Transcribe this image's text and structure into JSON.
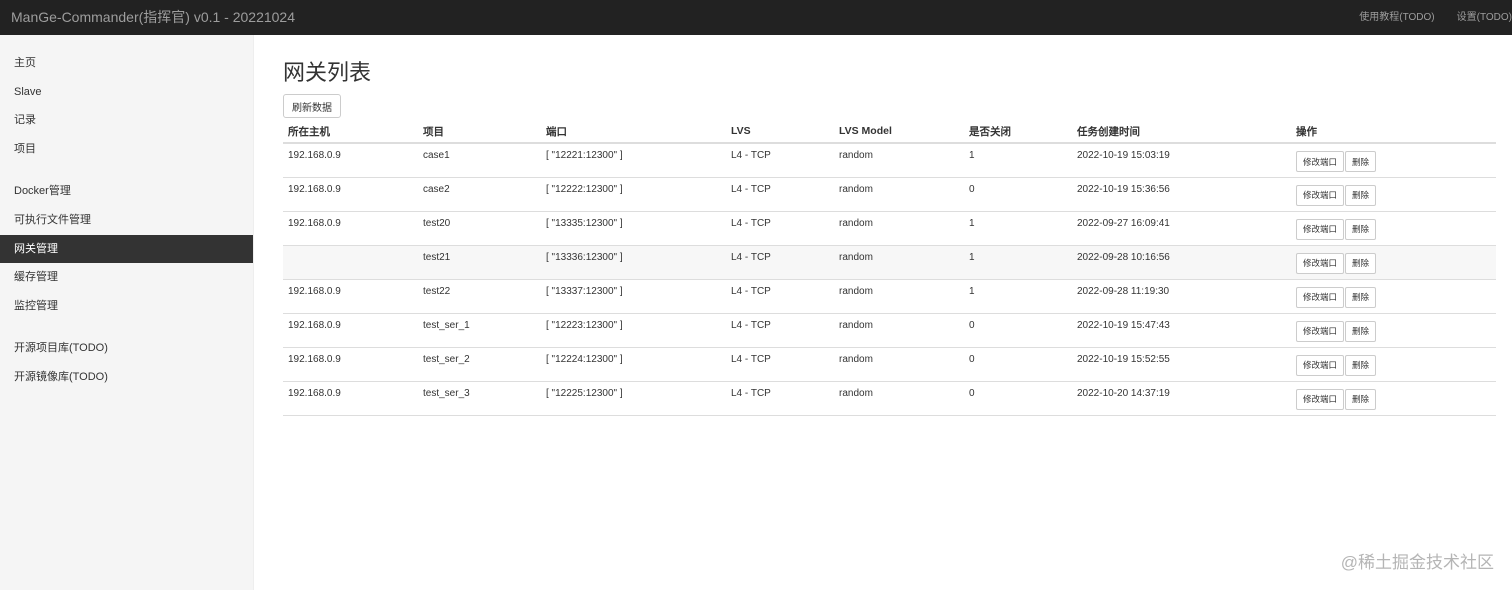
{
  "header": {
    "brand": "ManGe-Commander(指挥官) v0.1 - 20221024",
    "nav": [
      "使用教程(TODO)",
      "设置(TODO)"
    ]
  },
  "sidebar": {
    "groups": [
      [
        "主页",
        "Slave",
        "记录",
        "项目"
      ],
      [
        "Docker管理",
        "可执行文件管理",
        "网关管理",
        "缓存管理",
        "监控管理"
      ],
      [
        "开源项目库(TODO)",
        "开源镜像库(TODO)"
      ]
    ],
    "active": "网关管理"
  },
  "main": {
    "title": "网关列表",
    "refresh_label": "刷新数据",
    "table": {
      "columns": [
        "所在主机",
        "项目",
        "端口",
        "LVS",
        "LVS Model",
        "是否关闭",
        "任务创建时间",
        "操作"
      ],
      "rows": [
        [
          "192.168.0.9",
          "case1",
          "[ \"12221:12300\" ]",
          "L4 - TCP",
          "random",
          "1",
          "2022-10-19 15:03:19"
        ],
        [
          "192.168.0.9",
          "case2",
          "[ \"12222:12300\" ]",
          "L4 - TCP",
          "random",
          "0",
          "2022-10-19 15:36:56"
        ],
        [
          "192.168.0.9",
          "test20",
          "[ \"13335:12300\" ]",
          "L4 - TCP",
          "random",
          "1",
          "2022-09-27 16:09:41"
        ],
        [
          "",
          "test21",
          "[ \"13336:12300\" ]",
          "L4 - TCP",
          "random",
          "1",
          "2022-09-28 10:16:56"
        ],
        [
          "192.168.0.9",
          "test22",
          "[ \"13337:12300\" ]",
          "L4 - TCP",
          "random",
          "1",
          "2022-09-28 11:19:30"
        ],
        [
          "192.168.0.9",
          "test_ser_1",
          "[ \"12223:12300\" ]",
          "L4 - TCP",
          "random",
          "0",
          "2022-10-19 15:47:43"
        ],
        [
          "192.168.0.9",
          "test_ser_2",
          "[ \"12224:12300\" ]",
          "L4 - TCP",
          "random",
          "0",
          "2022-10-19 15:52:55"
        ],
        [
          "192.168.0.9",
          "test_ser_3",
          "[ \"12225:12300\" ]",
          "L4 - TCP",
          "random",
          "0",
          "2022-10-20 14:37:19"
        ]
      ],
      "action_labels": {
        "edit": "修改端口",
        "delete": "删除"
      }
    }
  },
  "watermark": "@稀土掘金技术社区"
}
